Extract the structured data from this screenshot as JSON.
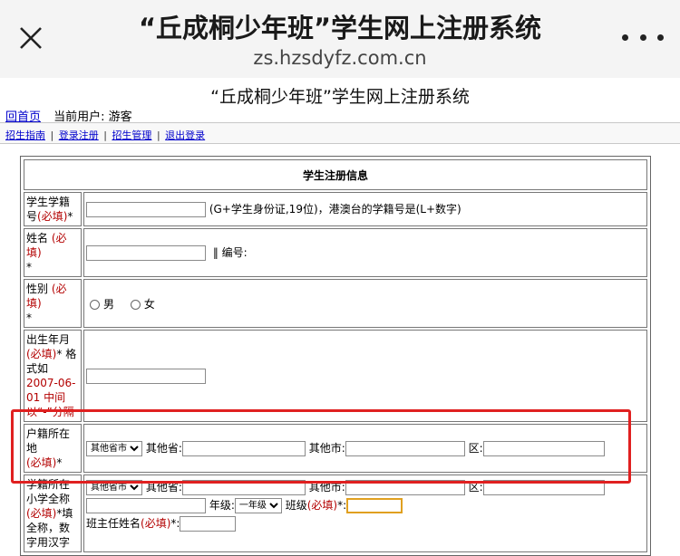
{
  "browser": {
    "title": "“丘成桐少年班”学生网上注册系统",
    "domain": "zs.hzsdyfz.com.cn"
  },
  "page": {
    "heading": "“丘成桐少年班”学生网上注册系统",
    "home_link": "回首页",
    "current_user_label": "当前用户: 游客"
  },
  "nav": {
    "items": [
      "招生指南",
      "登录注册",
      "招生管理",
      "退出登录"
    ],
    "separator": "|"
  },
  "form": {
    "section_title": "学生注册信息",
    "required": "(必填)",
    "student_id": {
      "label": "学生学籍号",
      "suffix": "*",
      "hint": "(G+学生身份证,19位)，港澳台的学籍号是(L+数字)",
      "value": ""
    },
    "name": {
      "label": "姓名",
      "suffix": "*",
      "extra": "‖  编号:",
      "value": ""
    },
    "gender": {
      "label": "性别",
      "suffix": "*",
      "options": [
        "男",
        "女"
      ]
    },
    "birth": {
      "label": "出生年月",
      "suffix": "* 格式如",
      "example": "2007-06-01 中间以“-”分隔",
      "value": ""
    },
    "household": {
      "label": "户籍所在地",
      "suffix": "*",
      "province_select": "其他省市",
      "other_province": "其他省:",
      "other_city": "其他市:",
      "district": "区:"
    },
    "school": {
      "label": "学籍所在小学全称",
      "suffix": "*填全称，数字用汉字",
      "province_select": "其他省市",
      "other_province": "其他省:",
      "other_city": "其他市:",
      "district": "区:",
      "grade_label": "年级:",
      "grade_select": "一年级",
      "class_label": "班级",
      "class_suffix": "*:",
      "teacher_label": "班主任姓名",
      "teacher_suffix": "*:"
    }
  }
}
